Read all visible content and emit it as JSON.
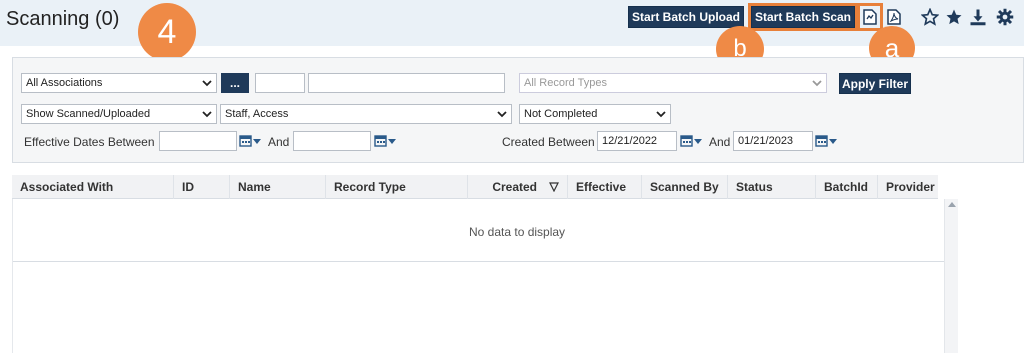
{
  "header": {
    "title": "Scanning (0)",
    "start_batch_upload": "Start Batch Upload",
    "start_batch_scan": "Start Batch Scan",
    "icons": [
      "scan-document-icon",
      "pdf-icon",
      "star-outline-icon",
      "star-filled-icon",
      "download-icon",
      "gear-icon"
    ]
  },
  "callouts": {
    "step": "4",
    "a": "a",
    "b": "b"
  },
  "colors": {
    "accent": "#1f3a5a",
    "callout": "#ef8a46",
    "header_bg": "#eaf1f7"
  },
  "filters": {
    "associations": "All Associations",
    "dots": "...",
    "record_types_placeholder": "All Record Types",
    "apply_filter": "Apply Filter",
    "scanned_uploaded": "Show Scanned/Uploaded",
    "staff_access": "Staff, Access",
    "completion": "Not Completed",
    "effective_dates_label": "Effective Dates Between",
    "and_label": "And",
    "created_between_label": "Created Between",
    "created_from": "12/21/2022",
    "created_to": "01/21/2023"
  },
  "grid": {
    "columns": [
      "Associated With",
      "ID",
      "Name",
      "Record Type",
      "Created",
      "Effective",
      "Scanned By",
      "Status",
      "BatchId",
      "Provider"
    ],
    "empty_message": "No data to display"
  }
}
